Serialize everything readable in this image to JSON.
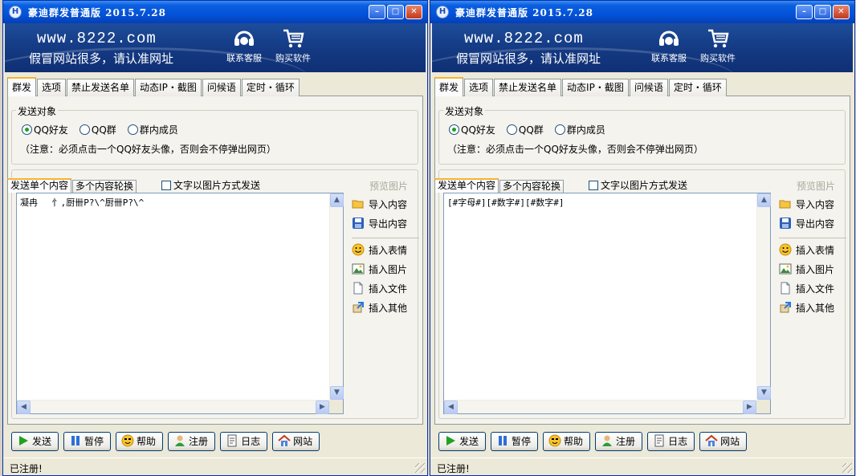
{
  "windows": [
    {
      "title": "豪迪群发普通版 2015.7.28",
      "banner": {
        "url": "www.8222.com",
        "slogan": "假冒网站很多，请认准网址",
        "support_label": "联系客服",
        "buy_label": "购买软件"
      },
      "tabs": [
        "群发",
        "选项",
        "禁止发送名单",
        "动态IP・截图",
        "问候语",
        "定时・循环"
      ],
      "target_group": {
        "legend": "发送对象",
        "options": [
          "QQ好友",
          "QQ群",
          "群内成员"
        ],
        "selected": "QQ好友",
        "note": "（注意：必须点击一个QQ好友头像，否则会不停弹出网页）"
      },
      "content_tabs": [
        "发送单个内容",
        "多个内容轮换"
      ],
      "image_send_checkbox": "文字以图片方式发送",
      "preview_label": "预览图片",
      "message_text": "凝冉　 忄,厨卌P?\\^厨卌P?\\^",
      "side_actions": [
        "导入内容",
        "导出内容",
        "插入表情",
        "插入图片",
        "插入文件",
        "插入其他"
      ],
      "bottom_buttons": [
        "发送",
        "暂停",
        "帮助",
        "注册",
        "日志",
        "网站"
      ],
      "status": "已注册!"
    },
    {
      "title": "豪迪群发普通版 2015.7.28",
      "banner": {
        "url": "www.8222.com",
        "slogan": "假冒网站很多，请认准网址",
        "support_label": "联系客服",
        "buy_label": "购买软件"
      },
      "tabs": [
        "群发",
        "选项",
        "禁止发送名单",
        "动态IP・截图",
        "问候语",
        "定时・循环"
      ],
      "target_group": {
        "legend": "发送对象",
        "options": [
          "QQ好友",
          "QQ群",
          "群内成员"
        ],
        "selected": "QQ好友",
        "note": "（注意：必须点击一个QQ好友头像，否则会不停弹出网页）"
      },
      "content_tabs": [
        "发送单个内容",
        "多个内容轮换"
      ],
      "image_send_checkbox": "文字以图片方式发送",
      "preview_label": "预览图片",
      "message_text": "[#字母#][#数字#][#数字#]",
      "side_actions": [
        "导入内容",
        "导出内容",
        "插入表情",
        "插入图片",
        "插入文件",
        "插入其他"
      ],
      "bottom_buttons": [
        "发送",
        "暂停",
        "帮助",
        "注册",
        "日志",
        "网站"
      ],
      "status": "已注册!"
    }
  ],
  "colors": {
    "title_blue": "#0453d8",
    "banner_navy": "#153c86",
    "tab_accent": "#f8b334",
    "status_ok": "#21a121"
  },
  "icons": [
    "app-logo-icon",
    "headset-icon",
    "cart-icon",
    "folder-icon",
    "floppy-icon",
    "smiley-icon",
    "picture-icon",
    "file-icon",
    "insert-other-icon",
    "play-icon",
    "pause-icon",
    "help-icon",
    "user-icon",
    "log-icon",
    "home-icon"
  ]
}
